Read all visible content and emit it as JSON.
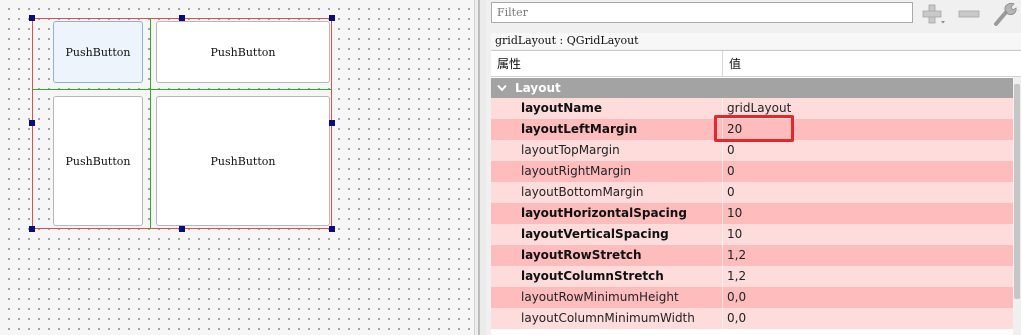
{
  "canvas": {
    "buttons": [
      {
        "label": "PushButton"
      },
      {
        "label": "PushButton"
      },
      {
        "label": "PushButton"
      },
      {
        "label": "PushButton"
      }
    ]
  },
  "toolbar": {
    "filter_placeholder": "Filter",
    "icons": [
      "plus-icon",
      "minus-icon",
      "wrench-icon"
    ]
  },
  "property_editor": {
    "object_label": "gridLayout : QGridLayout",
    "headers": {
      "property": "属性",
      "value": "值"
    },
    "group": "Layout",
    "rows": [
      {
        "name": "layoutName",
        "value": "gridLayout",
        "bold": true
      },
      {
        "name": "layoutLeftMargin",
        "value": "20",
        "bold": true
      },
      {
        "name": "layoutTopMargin",
        "value": "0",
        "bold": false
      },
      {
        "name": "layoutRightMargin",
        "value": "0",
        "bold": false
      },
      {
        "name": "layoutBottomMargin",
        "value": "0",
        "bold": false
      },
      {
        "name": "layoutHorizontalSpacing",
        "value": "10",
        "bold": true
      },
      {
        "name": "layoutVerticalSpacing",
        "value": "10",
        "bold": true
      },
      {
        "name": "layoutRowStretch",
        "value": "1,2",
        "bold": true
      },
      {
        "name": "layoutColumnStretch",
        "value": "1,2",
        "bold": true
      },
      {
        "name": "layoutRowMinimumHeight",
        "value": "0,0",
        "bold": false
      },
      {
        "name": "layoutColumnMinimumWidth",
        "value": "0,0",
        "bold": false
      }
    ]
  },
  "colors": {
    "row_light": "#ffdcdc",
    "row_dark": "#ffbcbc",
    "group_header": "#a3a3a3",
    "highlight_box": "#e0282e",
    "selection_handle": "#0a0a78",
    "layout_border": "#e05050",
    "grid_line": "#2faa2f"
  }
}
